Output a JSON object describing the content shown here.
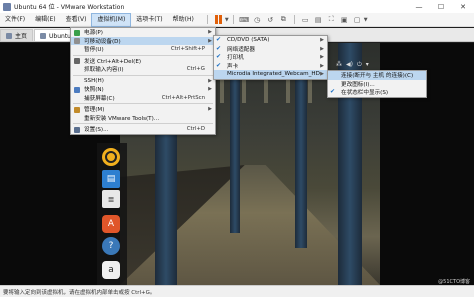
{
  "window": {
    "title": "Ubuntu 64 位 - VMware Workstation",
    "controls": [
      "—",
      "☐",
      "✕"
    ]
  },
  "menubar": {
    "items": [
      {
        "label": "文件(F)"
      },
      {
        "label": "编辑(E)"
      },
      {
        "label": "查看(V)"
      },
      {
        "label": "虚拟机(M)"
      },
      {
        "label": "选项卡(T)"
      },
      {
        "label": "帮助(H)"
      }
    ],
    "active_index": 3
  },
  "tabs": [
    {
      "label": "主页"
    },
    {
      "label": "Ubuntu 64 位"
    }
  ],
  "vm_menu": {
    "items": [
      {
        "label": "电源(P)",
        "submenu": true
      },
      {
        "label": "可移动设备(D)",
        "submenu": true,
        "highlighted": true
      },
      {
        "label": "暂停(U)",
        "shortcut": "Ctrl+Shift+P"
      },
      {
        "label": "发送 Ctrl+Alt+Del(E)"
      },
      {
        "label": "抓取输入内容(I)",
        "shortcut": "Ctrl+G"
      },
      {
        "label": "SSH(H)",
        "submenu": true
      },
      {
        "label": "快照(N)",
        "submenu": true
      },
      {
        "label": "捕获屏幕(C)",
        "shortcut": "Ctrl+Alt+PrtScn"
      },
      {
        "label": "管理(M)",
        "submenu": true
      },
      {
        "label": "重新安装 VMware Tools(T)..."
      },
      {
        "label": "设置(S)...",
        "shortcut": "Ctrl+D"
      }
    ]
  },
  "removable_menu": {
    "items": [
      {
        "label": "CD/DVD (SATA)",
        "checked": true
      },
      {
        "label": "网络适配器",
        "checked": true
      },
      {
        "label": "打印机",
        "checked": true
      },
      {
        "label": "声卡",
        "checked": true
      },
      {
        "label": "Microdia Integrated_Webcam_HD",
        "highlighted": true
      }
    ]
  },
  "webcam_menu": {
    "items": [
      {
        "label": "连接(断开与 主机 的连接)(C)",
        "highlighted": true
      },
      {
        "label": "更改图标(I)..."
      },
      {
        "label": "在状态栏中显示(S)",
        "checked": true
      }
    ]
  },
  "statusbar": {
    "text": "要将输入定向到该虚拟机，请在虚拟机内部单击或按 Ctrl+G。"
  },
  "watermark": "@51CTO博客"
}
